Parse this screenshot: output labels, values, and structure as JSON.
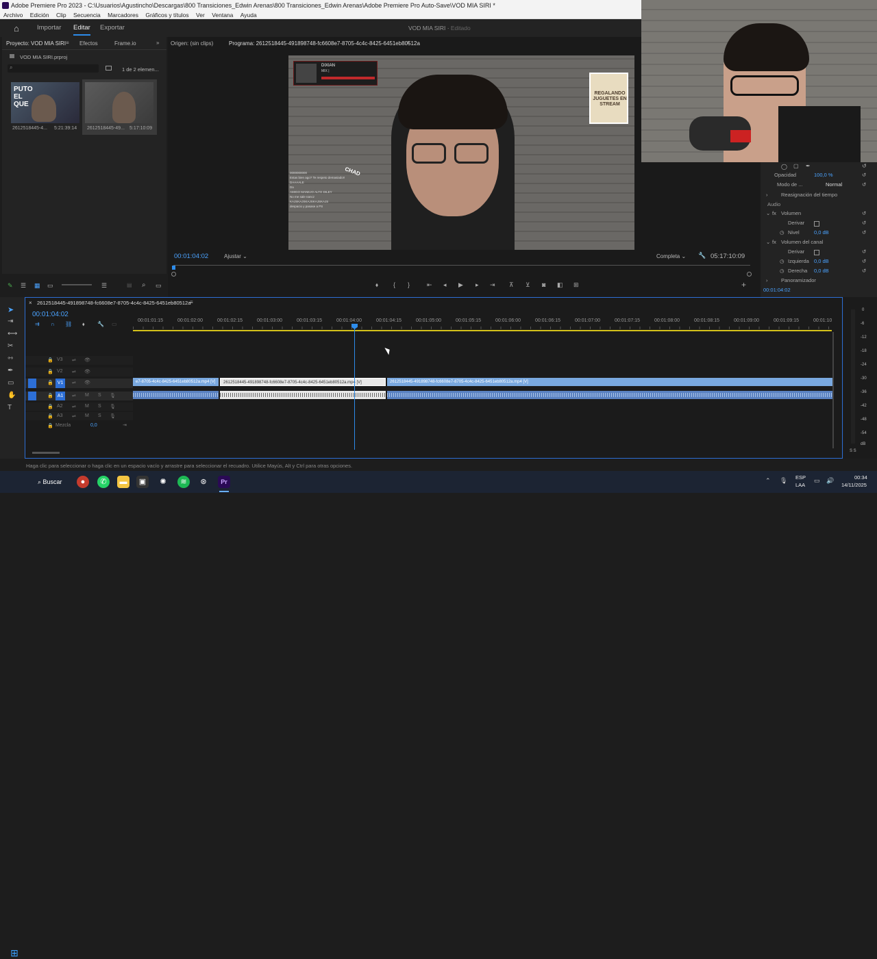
{
  "titlebar": {
    "title": "Adobe Premiere Pro 2023 - C:\\Usuarios\\Agustincho\\Descargas\\800 Transiciones_Edwin Arenas\\800 Transiciones_Edwin Arenas\\Adobe Premiere Pro Auto-Save\\VOD MIA SIRI *"
  },
  "menu": [
    "Archivo",
    "Edición",
    "Clip",
    "Secuencia",
    "Marcadores",
    "Gráficos y títulos",
    "Ver",
    "Ventana",
    "Ayuda"
  ],
  "workspace": {
    "tabs": [
      "Importar",
      "Editar",
      "Exportar"
    ],
    "active": "Editar",
    "project_title": "VOD MIA SIRI",
    "status": "Editado"
  },
  "project": {
    "tabs": [
      "Proyecto: VOD MIA SIRI",
      "Efectos",
      "Frame.io"
    ],
    "file": "VOD MIA SIRI.prproj",
    "count": "1 de 2 elemen...",
    "items": [
      {
        "name": "2612518445-4...",
        "duration": "5:21:39:14"
      },
      {
        "name": "2612518445-49...",
        "duration": "5:17:10:09"
      }
    ]
  },
  "program": {
    "tabs": [
      "Origen: (sin clips)",
      "Programa: 2612518445-491898748-fc6608e7-8705-4c4c-8425-6451eb80512a"
    ],
    "timecode": "00:01:04:02",
    "fit": "Ajustar",
    "quality": "Completa",
    "duration": "05:17:10:09",
    "overlay": {
      "player_name": "DIXIAN",
      "player_sub": "MIX |",
      "chat_tag": "CHAD",
      "promo": "REGALANDO JUGUETES EN STREAM",
      "chat_lines": [
        "0000000000",
        "Estas bien ago? Te respeto demasiado!!",
        "DAAAALE",
        "Da",
        "AMIGO MANEJO ALTO DILEY",
        "No me sale nancz",
        "KAJSKAJSKAJSKAJSKAJS",
        "despacio y pasase a PS"
      ]
    }
  },
  "effects": {
    "opacity_label": "Opacidad",
    "opacity_value": "100,0 %",
    "blend_label": "Modo de ...",
    "blend_value": "Normal",
    "remap": "Reasignación del tiempo",
    "audio": "Audio",
    "volume": "Volumen",
    "bypass": "Derivar",
    "level": "Nivel",
    "level_value": "0,0 dB",
    "channel_volume": "Volumen del canal",
    "left": "Izquierda",
    "left_value": "0,0 dB",
    "right": "Derecha",
    "right_value": "0,0 dB",
    "panner": "Panoramizador",
    "timecode": "00:01:04:02"
  },
  "timeline": {
    "sequence": "2612518445-491898748-fc6608e7-8705-4c4c-8425-6451eb80512a",
    "timecode": "00:01:04:02",
    "ruler": [
      "00:01:01:15",
      "00:01:02:00",
      "00:01:02:15",
      "00:01:03:00",
      "00:01:03:15",
      "00:01:04:00",
      "00:01:04:15",
      "00:01:05:00",
      "00:01:05:15",
      "00:01:06:00",
      "00:01:06:15",
      "00:01:07:00",
      "00:01:07:15",
      "00:01:08:00",
      "00:01:08:15",
      "00:01:09:00",
      "00:01:09:15",
      "00:01:10"
    ],
    "tracks": [
      "V3",
      "V2",
      "V1",
      "A1",
      "A2",
      "A3"
    ],
    "mix_label": "Mezcla",
    "mix_value": "0,0",
    "clips": {
      "v1_a": "e7-8705-4c4c-8425-6451eb80512a.mp4 [V]",
      "v1_b": "2612518445-491898748-fc6608e7-8705-4c4c-8425-6451eb80512a.mp4 [V]",
      "v1_c": "2612518445-491898748-fc6608e7-8705-4c4c-8425-6451eb80512a.mp4 [V]"
    }
  },
  "meters": {
    "scale": [
      "0",
      "-6",
      "-12",
      "-18",
      "-24",
      "-30",
      "-36",
      "-42",
      "-48",
      "-54",
      "dB"
    ],
    "solo": "S S"
  },
  "status_text": "Haga clic para seleccionar o haga clic en un espacio vacío y arrastre para seleccionar el recuadro. Utilice Mayús, Alt y Ctrl para otras opciones.",
  "taskbar": {
    "search": "Buscar",
    "lang_top": "ESP",
    "lang_bottom": "LAA",
    "time": "00:34",
    "date": "14/11/2025"
  }
}
